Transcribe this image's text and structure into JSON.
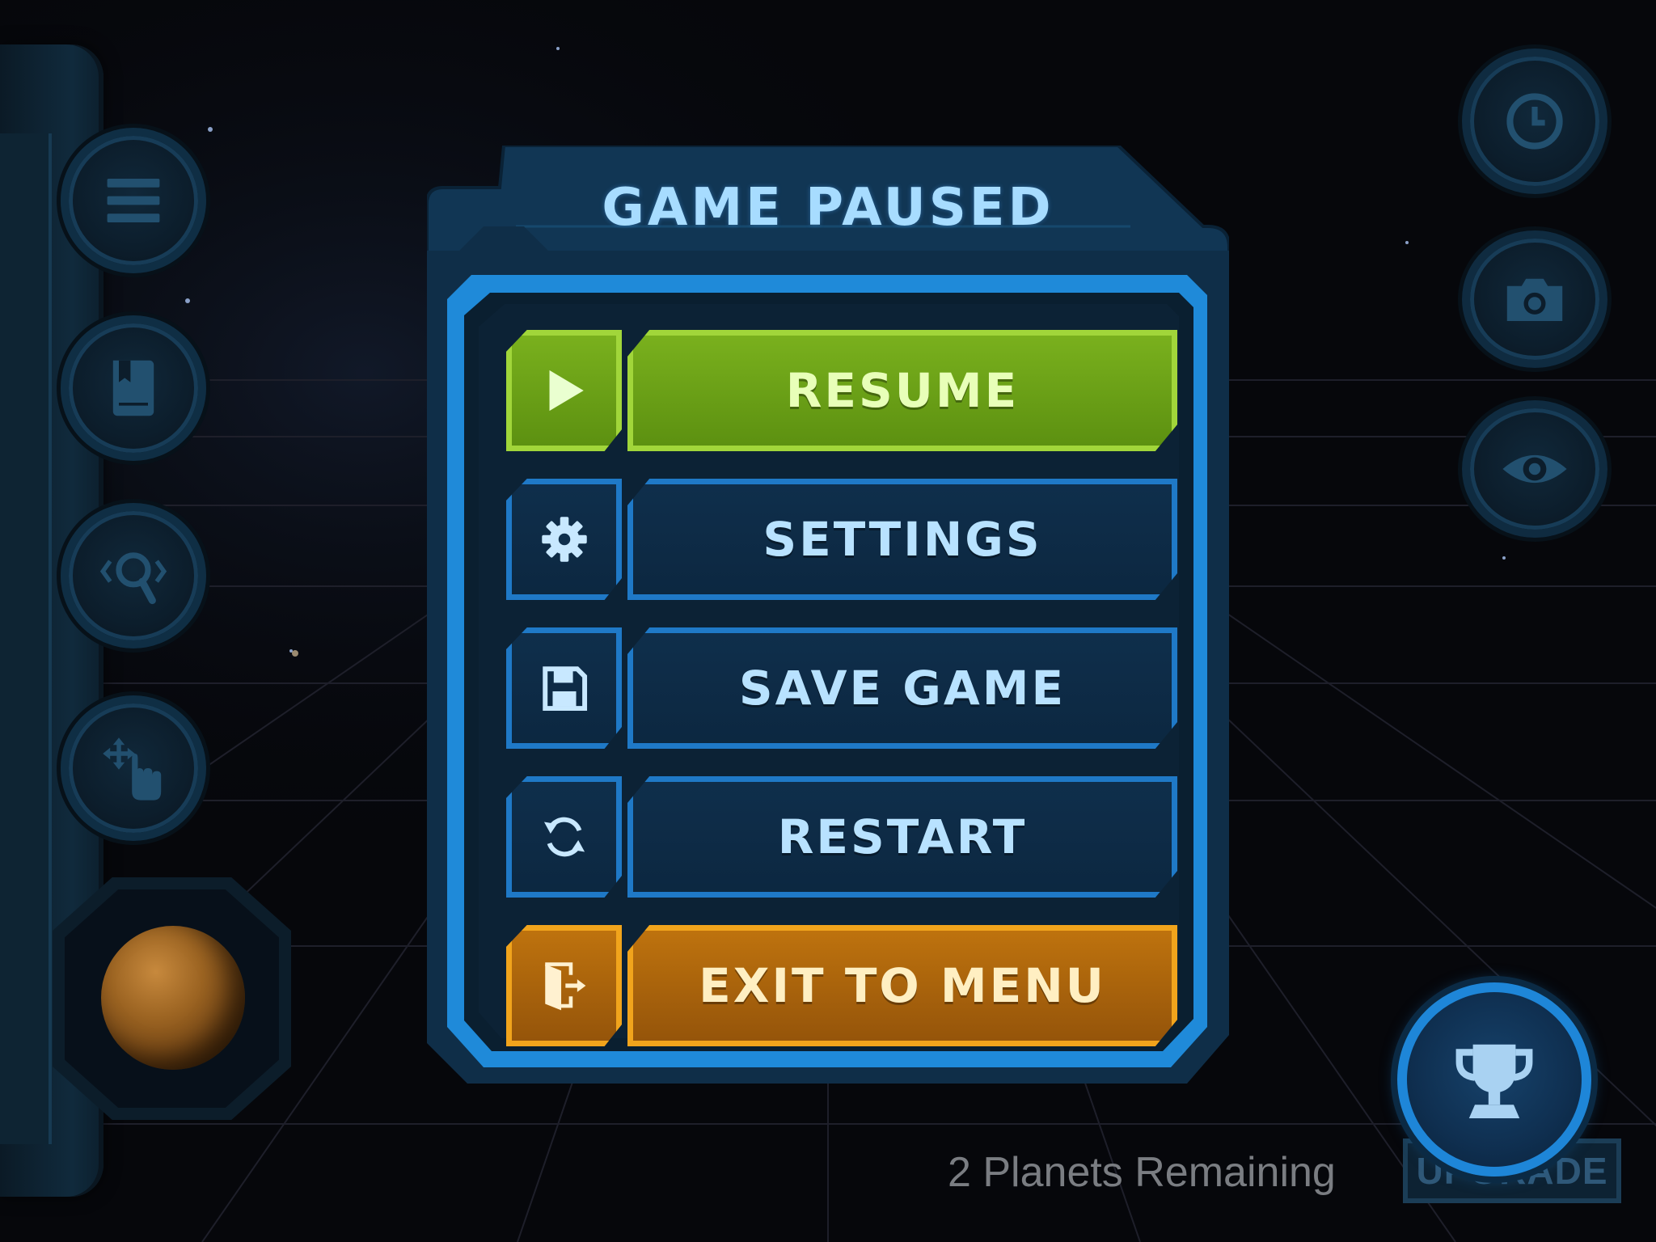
{
  "dialog": {
    "title": "GAME PAUSED",
    "items": [
      {
        "label": "RESUME",
        "icon": "play-icon",
        "color": "#7bb21e"
      },
      {
        "label": "SETTINGS",
        "icon": "gear-icon",
        "color": "#1f79c7"
      },
      {
        "label": "SAVE GAME",
        "icon": "floppy-disk-icon",
        "color": "#1f79c7"
      },
      {
        "label": "RESTART",
        "icon": "restart-icon",
        "color": "#1f79c7"
      },
      {
        "label": "EXIT TO MENU",
        "icon": "exit-door-icon",
        "color": "#f1a41c"
      }
    ]
  },
  "left_toolbar": {
    "buttons": [
      "menu-icon",
      "book-icon",
      "zoom-icon",
      "move-gesture-icon"
    ],
    "selected_planet": "planet-icon"
  },
  "right_toolbar": {
    "buttons": [
      "clock-icon",
      "camera-icon",
      "eye-icon"
    ]
  },
  "footer": {
    "status_text": "2 Planets Remaining",
    "upgrade_label": "UPGRADE",
    "trophy_icon": "trophy-icon"
  }
}
